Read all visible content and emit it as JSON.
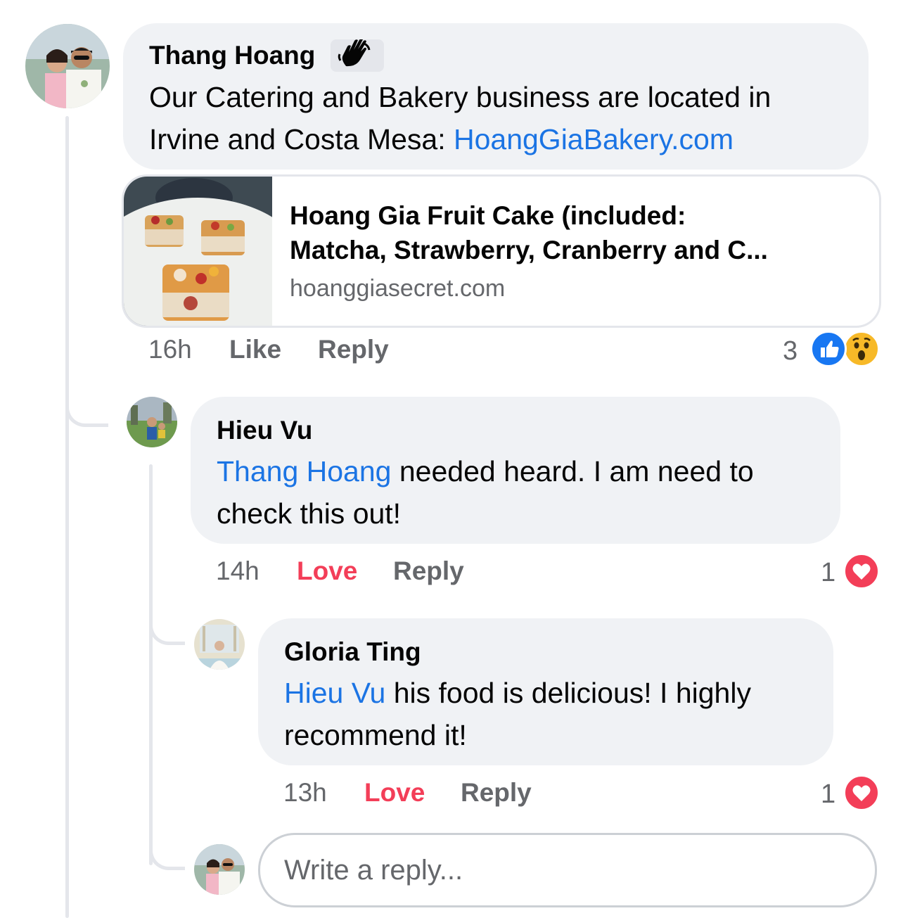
{
  "comments": [
    {
      "author": "Thang Hoang",
      "badge_icon": "waving-hand-icon",
      "text_parts": [
        "Our Catering and Bakery business are located in",
        "Irvine and Costa Mesa: "
      ],
      "link_text": "HoangGiaBakery.com",
      "link_preview": {
        "title": "Hoang Gia Fruit Cake (included: Matcha, Strawberry, Cranberry and C…",
        "title_line1": "Hoang Gia Fruit Cake (included:",
        "title_line2": "Matcha, Strawberry, Cranberry and C...",
        "domain": "hoanggiasecret.com"
      },
      "time": "16h",
      "like_label": "Like",
      "reply_label": "Reply",
      "reaction_count": "3",
      "reactions": [
        "like-icon",
        "wow-icon"
      ]
    },
    {
      "author": "Hieu Vu",
      "mention": "Thang Hoang",
      "text_line1_rest": " needed heard. I am need to",
      "text_line2": "check this out!",
      "time": "14h",
      "like_label": "Love",
      "reply_label": "Reply",
      "reaction_count": "1",
      "reactions": [
        "love-icon"
      ]
    },
    {
      "author": "Gloria Ting",
      "mention": "Hieu Vu",
      "text_line1_rest": " his food is delicious! I highly",
      "text_line2": "recommend it!",
      "time": "13h",
      "like_label": "Love",
      "reply_label": "Reply",
      "reaction_count": "1",
      "reactions": [
        "love-icon"
      ]
    }
  ],
  "reply_input": {
    "placeholder": "Write a reply..."
  },
  "colors": {
    "mention": "#1b74e4",
    "love": "#f33e58",
    "like": "#1877f2",
    "bubble": "#f0f2f5",
    "meta": "#65676b"
  }
}
